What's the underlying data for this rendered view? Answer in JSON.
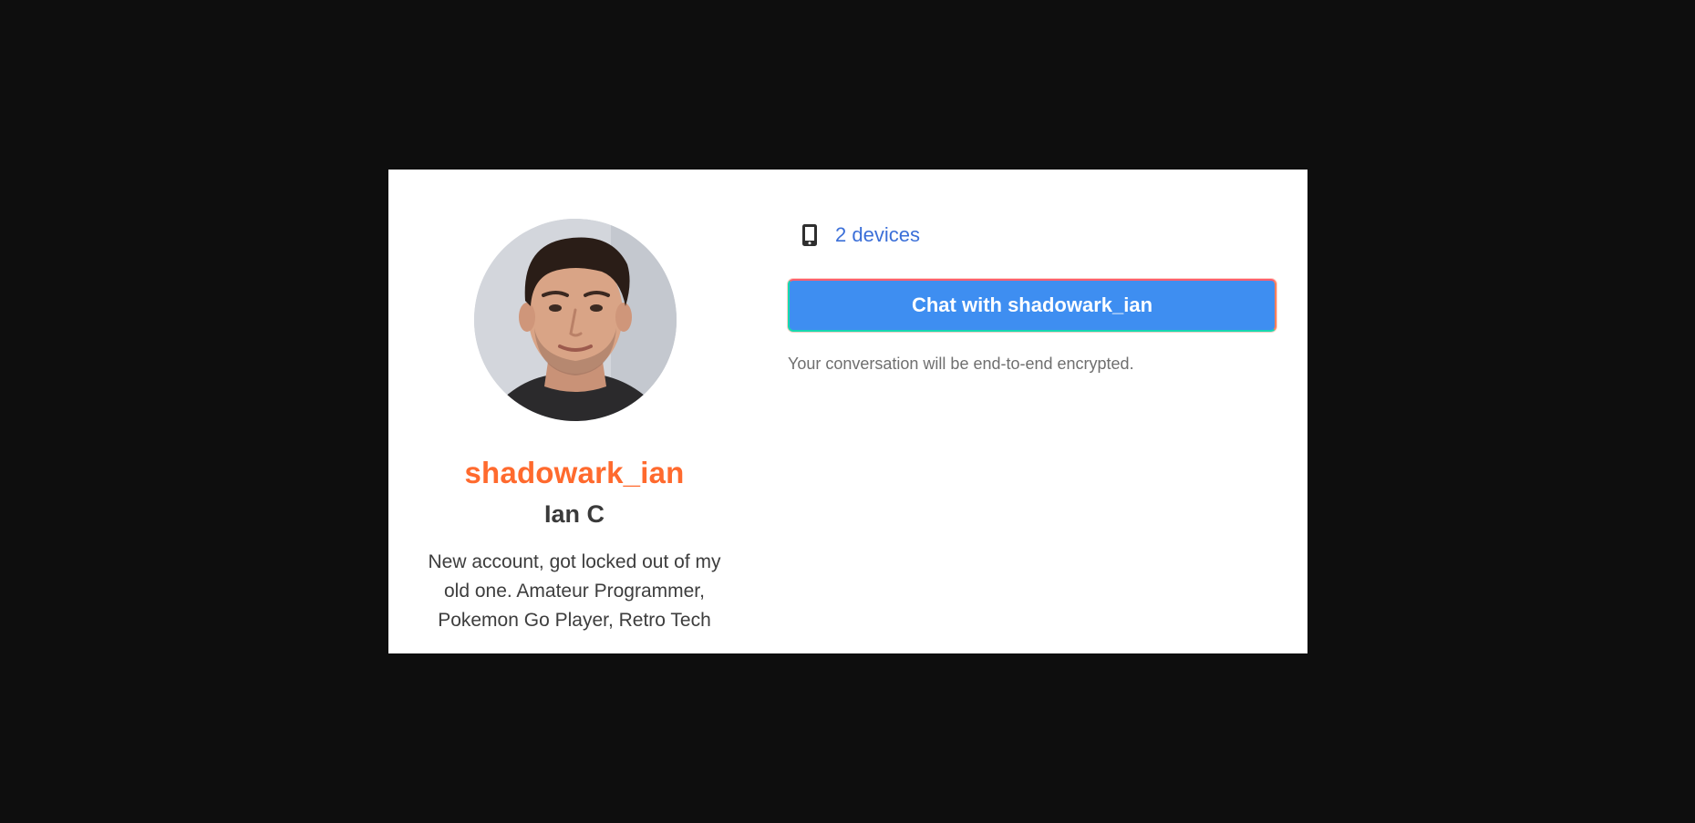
{
  "profile": {
    "username": "shadowark_ian",
    "full_name": "Ian C",
    "bio": "New account, got locked out of my old one. Amateur Programmer, Pokemon Go Player, Retro Tech",
    "avatar_icon": "profile-photo"
  },
  "devices": {
    "icon": "phone-icon",
    "label": "2 devices"
  },
  "chat": {
    "button_label": "Chat with shadowark_ian",
    "encryption_note": "Your conversation will be end-to-end encrypted."
  },
  "colors": {
    "background": "#0e0e0e",
    "card": "#ffffff",
    "username": "#ff6a2e",
    "link": "#3b6fd8",
    "button": "#3e8ef1"
  }
}
